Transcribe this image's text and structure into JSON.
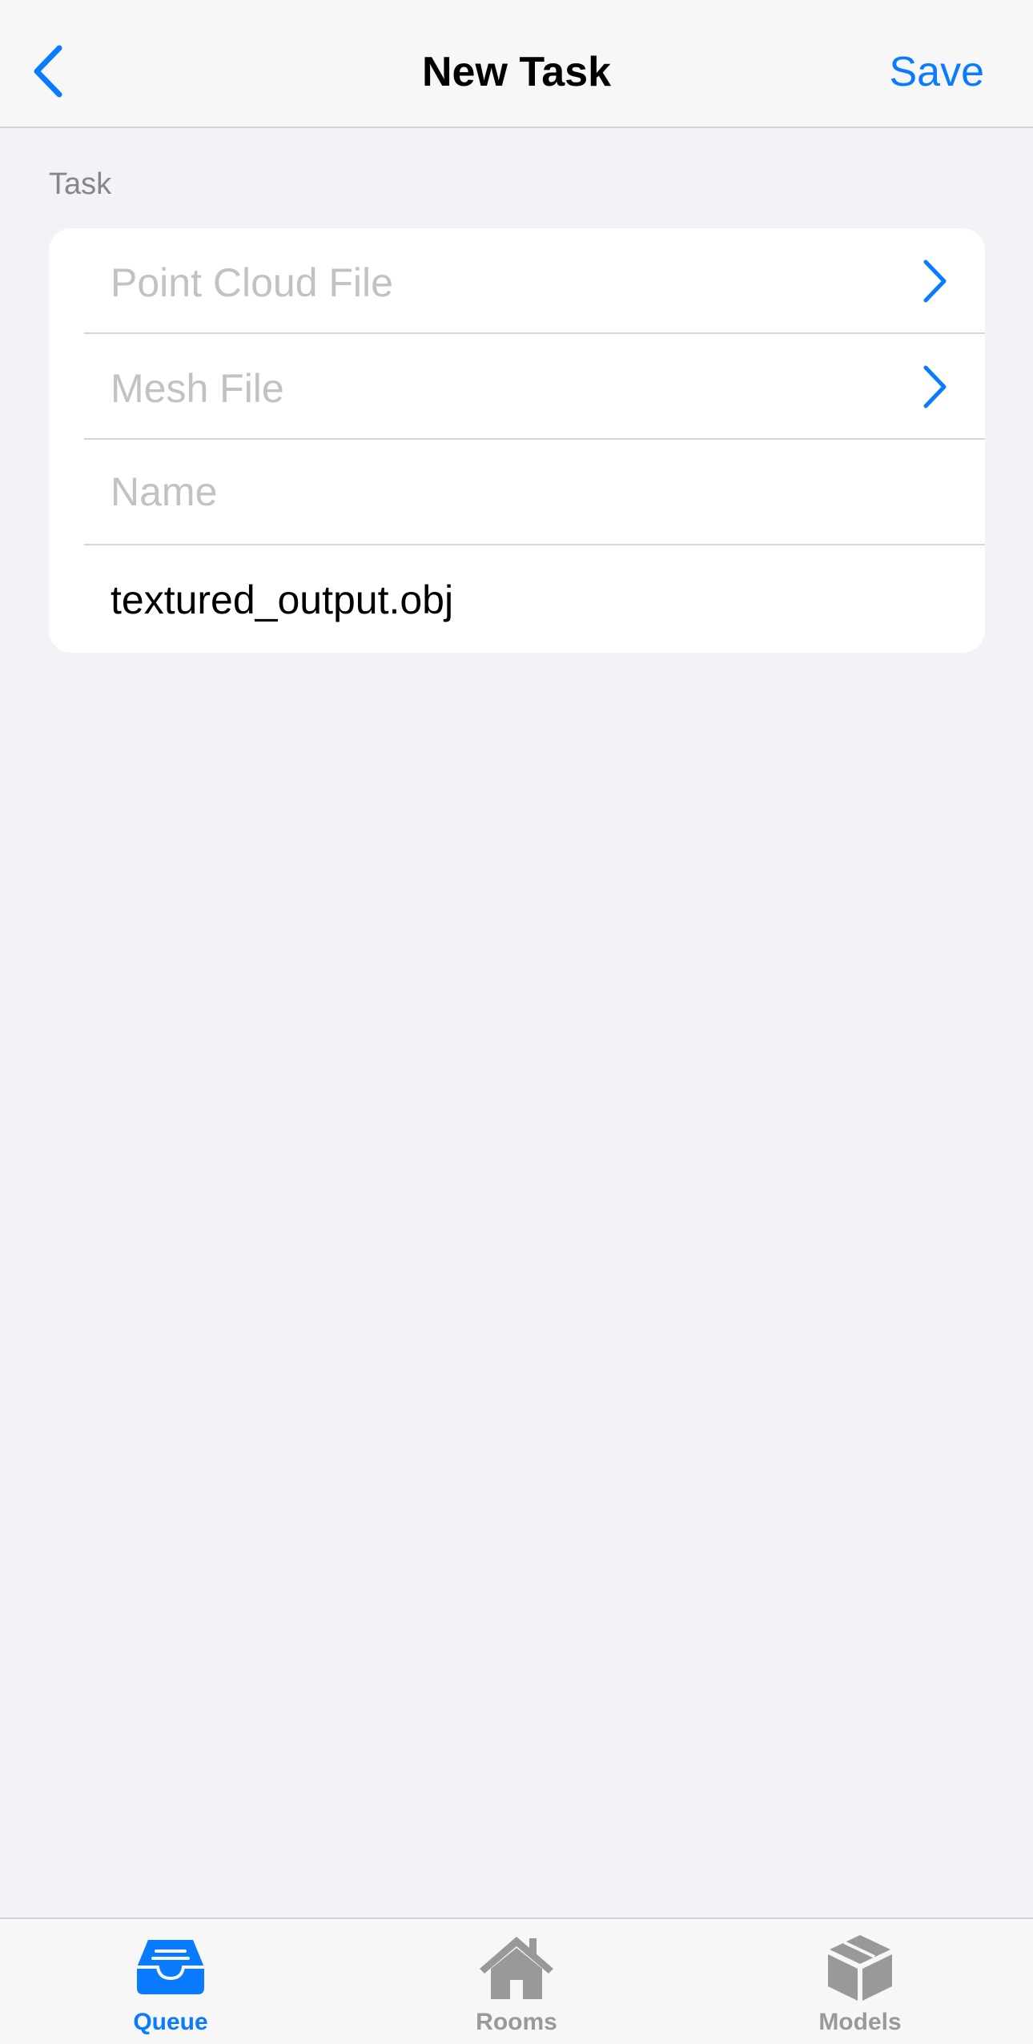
{
  "colors": {
    "accent": "#0a7aff",
    "tab_inactive": "#999999",
    "placeholder": "#c2c2c6",
    "background": "#f2f2f7"
  },
  "nav": {
    "back_icon": "chevron-left-icon",
    "title": "New Task",
    "save_label": "Save"
  },
  "section": {
    "header": "Task",
    "rows": [
      {
        "placeholder": "Point Cloud File",
        "icon": "chevron-right-icon"
      },
      {
        "placeholder": "Mesh File",
        "icon": "chevron-right-icon"
      },
      {
        "placeholder": "Name",
        "value": ""
      },
      {
        "value": "textured_output.obj"
      }
    ]
  },
  "tabs": [
    {
      "label": "Queue",
      "icon": "tray-icon",
      "selected": true
    },
    {
      "label": "Rooms",
      "icon": "house-icon",
      "selected": false
    },
    {
      "label": "Models",
      "icon": "cube-icon",
      "selected": false
    }
  ]
}
